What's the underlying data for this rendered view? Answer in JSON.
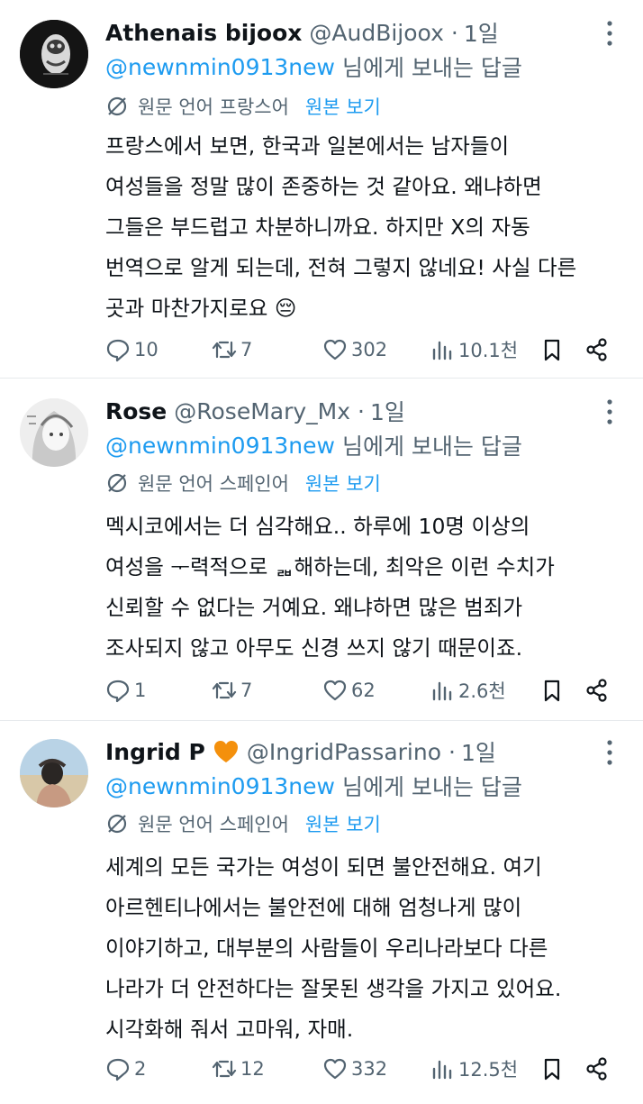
{
  "tweets": [
    {
      "name": "Athenais bijoox",
      "handle": "@AudBijoox",
      "dot": "·",
      "age": "1일",
      "mention": "@newnmin0913new",
      "reply_suffix": "님에게 보내는 답글",
      "translate_label": "원문 언어 프랑스어",
      "translate_link": "원본 보기",
      "lines": [
        "프랑스에서 보면, 한국과 일본에서는 남자들이",
        "여성들을 정말 많이 존중하는 것 같아요. 왜냐하면",
        "그들은 부드럽고 차분하니까요. 하지만 X의 자동",
        "번역으로 알게 되는데, 전혀 그렇지 않네요! 사실 다른",
        "곳과 마찬가지로요 😔"
      ],
      "replies": "10",
      "reposts": "7",
      "likes": "302",
      "views": "10.1천"
    },
    {
      "name": "Rose",
      "handle": "@RoseMary_Mx",
      "dot": "·",
      "age": "1일",
      "mention": "@newnmin0913new",
      "reply_suffix": "님에게 보내는 답글",
      "translate_label": "원문 언어 스페인어",
      "translate_link": "원본 보기",
      "lines": [
        "멕시코에서는 더 심각해요.. 하루에 10명 이상의",
        "여성을 ᅮ력적으로 ᆲ해하는데, 최악은 이런 수치가",
        "신뢰할 수 없다는 거예요. 왜냐하면 많은 범죄가",
        "조사되지 않고 아무도 신경 쓰지 않기 때문이죠."
      ],
      "replies": "1",
      "reposts": "7",
      "likes": "62",
      "views": "2.6천"
    },
    {
      "name": "Ingrid P",
      "handle": "@IngridPassarino",
      "dot": "·",
      "age": "1일",
      "mention": "@newnmin0913new",
      "reply_suffix": "님에게 보내는 답글",
      "translate_label": "원문 언어 스페인어",
      "translate_link": "원본 보기",
      "lines": [
        "세계의 모든 국가는 여성이 되면 불안전해요. 여기",
        "아르헨티나에서는 불안전에 대해 엄청나게 많이",
        "이야기하고, 대부분의 사람들이 우리나라보다 다른",
        "나라가 더 안전하다는 잘못된 생각을 가지고 있어요.",
        "시각화해 줘서 고마워, 자매."
      ],
      "replies": "2",
      "reposts": "12",
      "likes": "332",
      "views": "12.5천"
    }
  ],
  "colors": {
    "accent": "#1d9bf0",
    "secondary_text": "#536471",
    "primary_text": "#0f1419",
    "heart_badge": "#f4900c",
    "divider": "#e6e9ec"
  },
  "icons": {
    "translate": "translate-slash-icon",
    "reply": "speech-bubble-icon",
    "repost": "repost-arrows-icon",
    "like": "heart-icon",
    "views": "bar-chart-icon",
    "bookmark": "bookmark-icon",
    "share": "share-icon",
    "more": "more-vertical-icon"
  }
}
